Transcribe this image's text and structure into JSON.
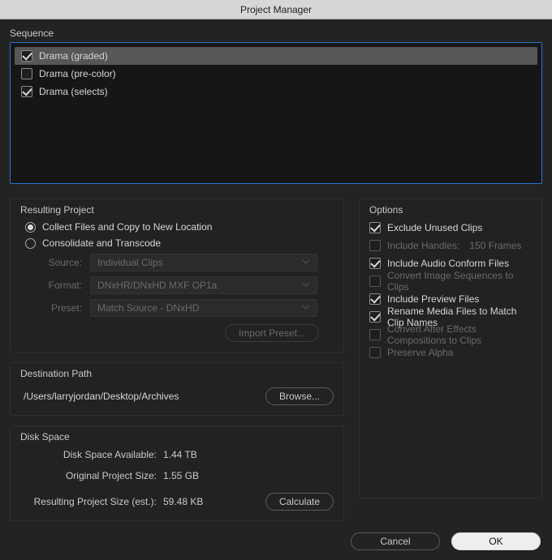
{
  "title": "Project Manager",
  "sequence": {
    "label": "Sequence",
    "items": [
      {
        "label": "Drama (graded)",
        "checked": true,
        "selected": true
      },
      {
        "label": "Drama (pre-color)",
        "checked": false,
        "selected": false
      },
      {
        "label": "Drama (selects)",
        "checked": true,
        "selected": false
      }
    ]
  },
  "resulting": {
    "label": "Resulting Project",
    "radio": {
      "collect": "Collect Files and Copy to New Location",
      "transcode": "Consolidate and Transcode",
      "selected": "collect"
    },
    "source": {
      "label": "Source:",
      "value": "Individual Clips"
    },
    "format": {
      "label": "Format:",
      "value": "DNxHR/DNxHD MXF OP1a"
    },
    "preset": {
      "label": "Preset:",
      "value": "Match Source - DNxHD"
    },
    "import_preset": "Import Preset..."
  },
  "options": {
    "label": "Options",
    "exclude_unused": {
      "label": "Exclude Unused Clips",
      "checked": true,
      "enabled": true
    },
    "include_handles": {
      "label": "Include Handles:",
      "value": "150 Frames",
      "checked": false,
      "enabled": false
    },
    "include_audio_conform": {
      "label": "Include Audio Conform Files",
      "checked": true,
      "enabled": true
    },
    "convert_img_seq": {
      "label": "Convert Image Sequences to Clips",
      "checked": false,
      "enabled": false
    },
    "include_preview": {
      "label": "Include Preview Files",
      "checked": true,
      "enabled": true
    },
    "rename_media": {
      "label": "Rename Media Files to Match Clip Names",
      "checked": true,
      "enabled": true
    },
    "convert_ae": {
      "label": "Convert After Effects Compositions to Clips",
      "checked": false,
      "enabled": false
    },
    "preserve_alpha": {
      "label": "Preserve Alpha",
      "checked": false,
      "enabled": false
    }
  },
  "dest": {
    "label": "Destination Path",
    "path": "/Users/larryjordan/Desktop/Archives",
    "browse": "Browse..."
  },
  "disk": {
    "label": "Disk Space",
    "available": {
      "label": "Disk Space Available:",
      "value": "1.44 TB"
    },
    "original": {
      "label": "Original Project Size:",
      "value": "1.55 GB"
    },
    "resulting": {
      "label": "Resulting Project Size (est.):",
      "value": "59.48 KB"
    },
    "calculate": "Calculate"
  },
  "footer": {
    "cancel": "Cancel",
    "ok": "OK"
  }
}
